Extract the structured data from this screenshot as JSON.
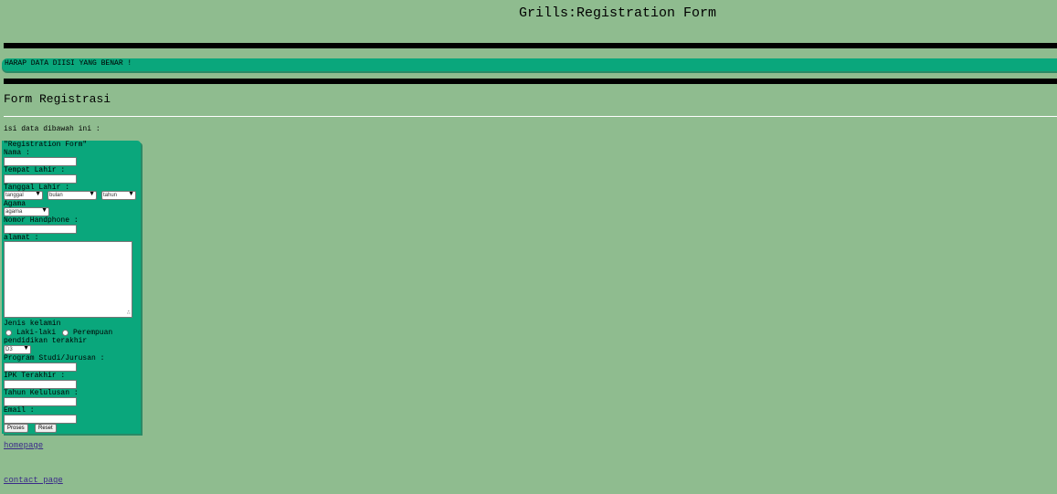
{
  "page": {
    "title": "Grills:Registration Form"
  },
  "banner": {
    "text": "HARAP DATA DIISI YANG BENAR !"
  },
  "section": {
    "title": "Form Registrasi",
    "intro": "isi data dibawah ini :"
  },
  "form": {
    "legend": "\"Registration Form\"",
    "nama_label": "Nama :",
    "tempat_label": "Tempat Lahir :",
    "tanggal_label": "Tanggal Lahir :",
    "tanggal_select": "tanggal",
    "bulan_select": "bulan",
    "tahun_select": "tahun",
    "agama_label": "Agama",
    "agama_select": "agama",
    "hp_label": "Nomor Handphone :",
    "alamat_label": "alamat :",
    "gender_label": "Jenis kelamin",
    "gender_male": "Laki-laki",
    "gender_female": "Perempuan",
    "pendidikan_label": "pendidikan terakhir",
    "pendidikan_select": "D3",
    "prodi_label": "Program Studi/Jurusan :",
    "ipk_label": "IPK Terakhir :",
    "tahun_lulus_label": "Tahun Kelulusan :",
    "email_label": "Email :",
    "submit_label": "Proses",
    "reset_label": "Reset"
  },
  "links": {
    "homepage": "homepage",
    "contact": "contact page"
  }
}
